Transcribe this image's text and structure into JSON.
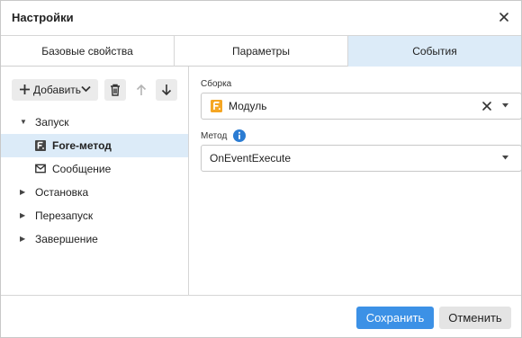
{
  "dialog": {
    "title": "Настройки"
  },
  "tabs": [
    {
      "label": "Базовые свойства"
    },
    {
      "label": "Параметры"
    },
    {
      "label": "События",
      "active": true
    }
  ],
  "toolbar": {
    "add_label": "Добавить"
  },
  "tree": {
    "n0": {
      "label": "Запуск",
      "expanded": true
    },
    "n0c0": {
      "label": "Fore-метод",
      "selected": true,
      "icon": "fore-method-icon"
    },
    "n0c1": {
      "label": "Сообщение",
      "icon": "envelope-icon"
    },
    "n1": {
      "label": "Остановка",
      "expanded": false
    },
    "n2": {
      "label": "Перезапуск",
      "expanded": false
    },
    "n3": {
      "label": "Завершение",
      "expanded": false
    }
  },
  "form": {
    "assembly": {
      "label": "Сборка",
      "value": "Модуль",
      "icon": "module-icon"
    },
    "method": {
      "label": "Метод",
      "value": "OnEventExecute"
    }
  },
  "footer": {
    "save_label": "Сохранить",
    "cancel_label": "Отменить"
  },
  "colors": {
    "accent": "#3c91e6",
    "selection": "#dcebf8",
    "module_icon": "#f5a623",
    "info_icon": "#2b7cd3"
  }
}
